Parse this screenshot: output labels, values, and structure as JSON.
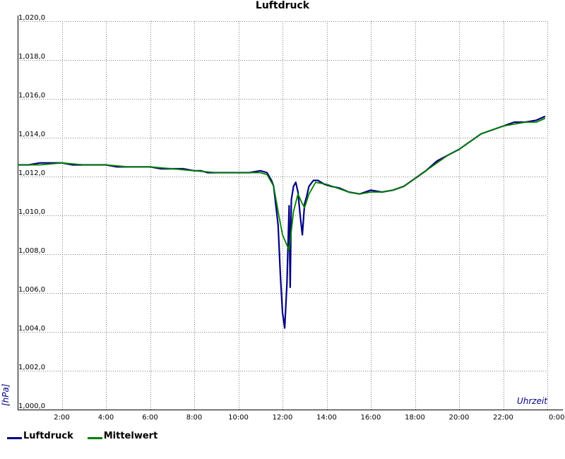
{
  "chart_data": {
    "type": "line",
    "title": "Luftdruck",
    "xlabel": "Uhrzeit",
    "ylabel": "[hPa]",
    "x_unit": "hours",
    "xlim": [
      0,
      24
    ],
    "ylim": [
      1000,
      1020
    ],
    "grid": true,
    "legend_position": "bottom-left",
    "x_ticks": [
      {
        "value": 0,
        "label": ""
      },
      {
        "value": 2,
        "label": "2:00"
      },
      {
        "value": 4,
        "label": "4:00"
      },
      {
        "value": 6,
        "label": "6:00"
      },
      {
        "value": 8,
        "label": "8:00"
      },
      {
        "value": 10,
        "label": "10:00"
      },
      {
        "value": 12,
        "label": "12:00"
      },
      {
        "value": 14,
        "label": "14:00"
      },
      {
        "value": 16,
        "label": "16:00"
      },
      {
        "value": 18,
        "label": "18:00"
      },
      {
        "value": 20,
        "label": "20:00"
      },
      {
        "value": 22,
        "label": "22:00"
      },
      {
        "value": 24,
        "label": "0:00"
      }
    ],
    "y_ticks": [
      {
        "value": 1000,
        "label": "1,000,0"
      },
      {
        "value": 1002,
        "label": "1,002,0"
      },
      {
        "value": 1004,
        "label": "1,004,0"
      },
      {
        "value": 1006,
        "label": "1,006,0"
      },
      {
        "value": 1008,
        "label": "1,008,0"
      },
      {
        "value": 1010,
        "label": "1,010,0"
      },
      {
        "value": 1012,
        "label": "1,012,0"
      },
      {
        "value": 1014,
        "label": "1,014,0"
      },
      {
        "value": 1016,
        "label": "1,016,0"
      },
      {
        "value": 1018,
        "label": "1,018,0"
      },
      {
        "value": 1020,
        "label": "1,020,0"
      }
    ],
    "series": [
      {
        "name": "Luftdruck",
        "color": "#000080",
        "x": [
          0,
          0.5,
          1,
          1.5,
          2,
          2.5,
          3,
          3.5,
          4,
          4.5,
          5,
          5.5,
          6,
          6.5,
          7,
          7.5,
          8,
          8.3,
          8.6,
          9,
          9.5,
          10,
          10.5,
          11,
          11.3,
          11.5,
          11.6,
          11.8,
          11.9,
          12.0,
          12.1,
          12.2,
          12.3,
          12.35,
          12.4,
          12.5,
          12.6,
          12.7,
          12.8,
          12.9,
          13.0,
          13.1,
          13.2,
          13.4,
          13.6,
          13.9,
          14.2,
          14.6,
          15.0,
          15.5,
          16.0,
          16.5,
          17.0,
          17.5,
          18.0,
          18.5,
          19.0,
          19.5,
          20.0,
          20.5,
          21.0,
          21.5,
          22.0,
          22.5,
          23.0,
          23.5,
          23.9
        ],
        "values": [
          1012.6,
          1012.6,
          1012.7,
          1012.7,
          1012.7,
          1012.6,
          1012.6,
          1012.6,
          1012.6,
          1012.5,
          1012.5,
          1012.5,
          1012.5,
          1012.4,
          1012.4,
          1012.4,
          1012.3,
          1012.3,
          1012.2,
          1012.2,
          1012.2,
          1012.2,
          1012.2,
          1012.3,
          1012.2,
          1011.8,
          1011.5,
          1009.5,
          1007.0,
          1005.0,
          1004.2,
          1006.5,
          1010.5,
          1006.3,
          1010.8,
          1011.5,
          1011.7,
          1011.2,
          1010.0,
          1009.0,
          1010.6,
          1011.0,
          1011.5,
          1011.8,
          1011.8,
          1011.6,
          1011.5,
          1011.4,
          1011.2,
          1011.1,
          1011.3,
          1011.2,
          1011.3,
          1011.5,
          1011.9,
          1012.3,
          1012.8,
          1013.1,
          1013.4,
          1013.8,
          1014.2,
          1014.4,
          1014.6,
          1014.8,
          1014.8,
          1014.9,
          1015.1
        ]
      },
      {
        "name": "Mittelwert",
        "color": "#008000",
        "x": [
          0,
          1,
          2,
          3,
          4,
          5,
          6,
          7,
          8,
          9,
          10,
          11,
          11.3,
          11.6,
          11.8,
          12.0,
          12.3,
          12.5,
          12.7,
          12.9,
          13.0,
          13.2,
          13.5,
          14.0,
          14.5,
          15.0,
          15.5,
          16.0,
          16.5,
          17.0,
          17.5,
          18.0,
          18.5,
          19.0,
          19.5,
          20.0,
          20.5,
          21.0,
          21.5,
          22.0,
          22.5,
          23.0,
          23.5,
          23.9
        ],
        "values": [
          1012.6,
          1012.6,
          1012.7,
          1012.6,
          1012.6,
          1012.5,
          1012.5,
          1012.4,
          1012.3,
          1012.2,
          1012.2,
          1012.2,
          1012.1,
          1011.5,
          1010.2,
          1009.0,
          1008.2,
          1010.2,
          1011.1,
          1010.6,
          1010.4,
          1011.1,
          1011.7,
          1011.6,
          1011.4,
          1011.2,
          1011.1,
          1011.2,
          1011.2,
          1011.3,
          1011.5,
          1011.9,
          1012.3,
          1012.7,
          1013.1,
          1013.4,
          1013.8,
          1014.2,
          1014.4,
          1014.6,
          1014.7,
          1014.8,
          1014.8,
          1015.0
        ]
      }
    ]
  }
}
